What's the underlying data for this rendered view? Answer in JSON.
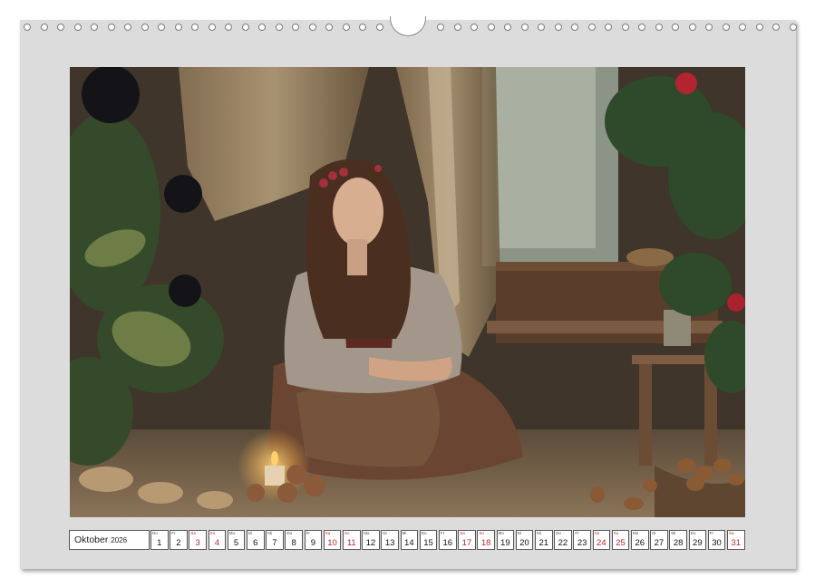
{
  "calendar": {
    "month_label": "Oktober",
    "year_label": "2026",
    "weekend_color": "#c0262d",
    "days": [
      {
        "dow": "Do",
        "num": "1",
        "weekend": false
      },
      {
        "dow": "Fr",
        "num": "2",
        "weekend": false
      },
      {
        "dow": "Sa",
        "num": "3",
        "weekend": true
      },
      {
        "dow": "So",
        "num": "4",
        "weekend": true
      },
      {
        "dow": "Mo",
        "num": "5",
        "weekend": false
      },
      {
        "dow": "Di",
        "num": "6",
        "weekend": false
      },
      {
        "dow": "Mi",
        "num": "7",
        "weekend": false
      },
      {
        "dow": "Do",
        "num": "8",
        "weekend": false
      },
      {
        "dow": "Fr",
        "num": "9",
        "weekend": false
      },
      {
        "dow": "Sa",
        "num": "10",
        "weekend": true
      },
      {
        "dow": "So",
        "num": "11",
        "weekend": true
      },
      {
        "dow": "Mo",
        "num": "12",
        "weekend": false
      },
      {
        "dow": "Di",
        "num": "13",
        "weekend": false
      },
      {
        "dow": "Mi",
        "num": "14",
        "weekend": false
      },
      {
        "dow": "Do",
        "num": "15",
        "weekend": false
      },
      {
        "dow": "Fr",
        "num": "16",
        "weekend": false
      },
      {
        "dow": "Sa",
        "num": "17",
        "weekend": true
      },
      {
        "dow": "So",
        "num": "18",
        "weekend": true
      },
      {
        "dow": "Mo",
        "num": "19",
        "weekend": false
      },
      {
        "dow": "Di",
        "num": "20",
        "weekend": false
      },
      {
        "dow": "Mi",
        "num": "21",
        "weekend": false
      },
      {
        "dow": "Do",
        "num": "22",
        "weekend": false
      },
      {
        "dow": "Fr",
        "num": "23",
        "weekend": false
      },
      {
        "dow": "Sa",
        "num": "24",
        "weekend": true
      },
      {
        "dow": "So",
        "num": "25",
        "weekend": true
      },
      {
        "dow": "Mo",
        "num": "26",
        "weekend": false
      },
      {
        "dow": "Di",
        "num": "27",
        "weekend": false
      },
      {
        "dow": "Mi",
        "num": "28",
        "weekend": false
      },
      {
        "dow": "Do",
        "num": "29",
        "weekend": false
      },
      {
        "dow": "Fr",
        "num": "30",
        "weekend": false
      },
      {
        "dow": "Sa",
        "num": "31",
        "weekend": true
      }
    ]
  },
  "photo": {
    "subject": "woman-sitting-in-garden-hut-icon"
  }
}
